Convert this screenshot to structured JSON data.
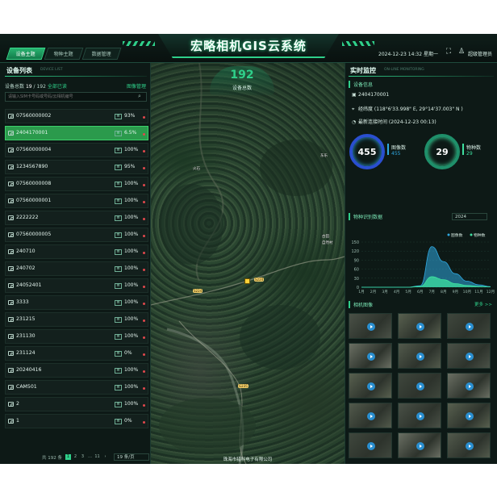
{
  "header": {
    "title": "宏略相机GIS云系统",
    "tabs": [
      {
        "label": "设备主题",
        "active": true
      },
      {
        "label": "物种主题",
        "active": false
      },
      {
        "label": "数据管理",
        "active": false
      }
    ],
    "datetime": "2024-12-23 14:32 星期一",
    "user_name": "超级管理员",
    "icons": [
      "fullscreen-icon",
      "user-icon"
    ]
  },
  "left_panel": {
    "title": "设备列表",
    "subtitle": "DEVICE LIST",
    "count_label": "设备总数",
    "online_count": "19",
    "total_count": "192",
    "online_label": "全部已读",
    "image_mgmt": "图像管理",
    "search_placeholder": "请输入SIM卡号码或号码/云相机编号",
    "devices": [
      {
        "id": "07560000002",
        "battery": "93%",
        "selected": false
      },
      {
        "id": "2404170001",
        "battery": "6.5%",
        "selected": true
      },
      {
        "id": "07560000004",
        "battery": "100%",
        "selected": false
      },
      {
        "id": "1234567890",
        "battery": "95%",
        "selected": false
      },
      {
        "id": "07560000008",
        "battery": "100%",
        "selected": false
      },
      {
        "id": "07560000001",
        "battery": "100%",
        "selected": false
      },
      {
        "id": "2222222",
        "battery": "100%",
        "selected": false
      },
      {
        "id": "07560000005",
        "battery": "100%",
        "selected": false
      },
      {
        "id": "240710",
        "battery": "100%",
        "selected": false
      },
      {
        "id": "240702",
        "battery": "100%",
        "selected": false
      },
      {
        "id": "24052401",
        "battery": "100%",
        "selected": false
      },
      {
        "id": "3333",
        "battery": "100%",
        "selected": false
      },
      {
        "id": "231215",
        "battery": "100%",
        "selected": false
      },
      {
        "id": "231130",
        "battery": "100%",
        "selected": false
      },
      {
        "id": "231124",
        "battery": "0%",
        "selected": false
      },
      {
        "id": "20240416",
        "battery": "100%",
        "selected": false
      },
      {
        "id": "CAM501",
        "battery": "100%",
        "selected": false
      },
      {
        "id": "2",
        "battery": "100%",
        "selected": false
      },
      {
        "id": "1",
        "battery": "0%",
        "selected": false
      }
    ],
    "pager": {
      "total_text": "共 192 条",
      "pages": [
        "1",
        "2",
        "3",
        "…",
        "11"
      ],
      "current_page": "1",
      "page_size": "19 条/页"
    }
  },
  "map": {
    "total_devices": "192",
    "total_label": "设备总数",
    "place_labels": [
      "火石",
      "东乐",
      "古田",
      "自然村"
    ],
    "road_labels": [
      "S224",
      "S224",
      "G235"
    ],
    "company": "珠海市猎科电子有限公司"
  },
  "right_panel": {
    "title": "实时监控",
    "subtitle": "ON-LINE MONITORING",
    "device_info_title": "设备信息",
    "device_id": "2404170001",
    "location": "经纬度 (118°6'33.998\" E, 29°14'37.003\" N )",
    "last_connected": "最新连接时间 (2024-12-23 00:13)",
    "stats": {
      "image_count": "455",
      "image_label": "图像数",
      "species_count": "29",
      "species_label": "物种数"
    },
    "chart_title": "物种识别数据",
    "year": "2024",
    "gallery_title": "相机图像",
    "more_link": "更多 >>",
    "thumbnail_count": 15
  },
  "colors": {
    "accent": "#2fd08a",
    "images_series": "#2fa8e0",
    "species_series": "#3ee0a0",
    "alert": "#e0474c",
    "selected_row": "#2b9a4c"
  },
  "chart_data": {
    "type": "area",
    "x": [
      "1月",
      "2月",
      "3月",
      "4月",
      "5月",
      "6月",
      "7月",
      "8月",
      "9月",
      "10月",
      "11月",
      "12月"
    ],
    "series": [
      {
        "name": "图像数",
        "values": [
          0,
          0,
          0,
          0,
          0,
          5,
          135,
          85,
          45,
          20,
          8,
          2
        ]
      },
      {
        "name": "物种数",
        "values": [
          0,
          0,
          0,
          0,
          0,
          3,
          35,
          25,
          12,
          6,
          3,
          1
        ]
      }
    ],
    "yticks": [
      "0",
      "30",
      "60",
      "90",
      "120",
      "150"
    ],
    "ylim": [
      0,
      150
    ],
    "legend": "top-right"
  }
}
